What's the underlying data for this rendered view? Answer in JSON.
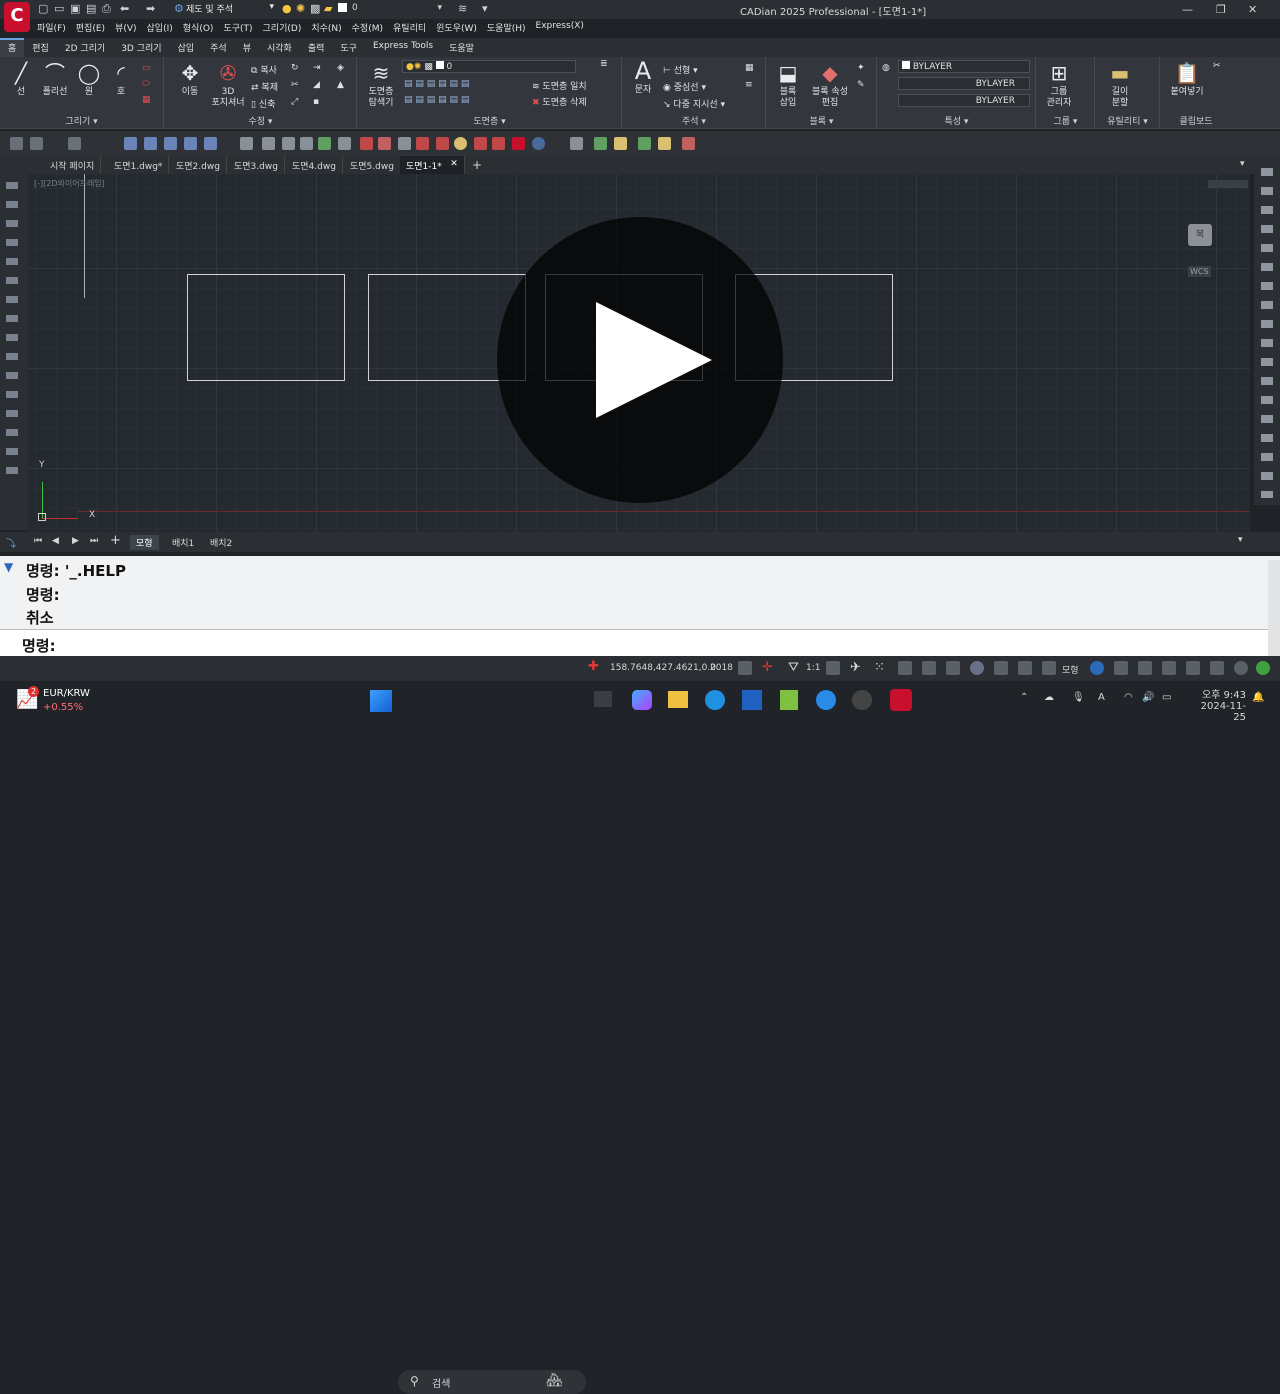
{
  "app": {
    "title": "CADian 2025 Professional - [도면1-1*]",
    "logo": "C"
  },
  "quick_access": {
    "workspace": "제도 및 주석",
    "layer_value": "0"
  },
  "menu": [
    "파일(F)",
    "편집(E)",
    "뷰(V)",
    "삽입(I)",
    "형식(O)",
    "도구(T)",
    "그리기(D)",
    "치수(N)",
    "수정(M)",
    "유틸리티",
    "윈도우(W)",
    "도움말(H)",
    "Express(X)"
  ],
  "ribbon_tabs": [
    "홈",
    "편집",
    "2D 그리기",
    "3D 그리기",
    "삽입",
    "주석",
    "뷰",
    "시각화",
    "출력",
    "도구",
    "Express Tools",
    "도움말"
  ],
  "ribbon": {
    "draw": {
      "label": "그리기 ▾",
      "line": "선",
      "polyline": "폴리선",
      "circle": "원",
      "arc": "호"
    },
    "modify": {
      "label": "수정 ▾",
      "move": "이동",
      "gizmo1": "3D",
      "gizmo2": "포지셔너",
      "copy": "복사",
      "mirror": "복제",
      "stretch": "신축"
    },
    "layer": {
      "label": "도면층 ▾",
      "manager1": "도면층",
      "manager2": "탐색기",
      "match": "도면층 일치",
      "delete": "도면층 삭제",
      "current": "0"
    },
    "annotation": {
      "label": "주석 ▾",
      "text": "문자",
      "linear": "선형",
      "center": "중심선",
      "multileader": "다중 지시선"
    },
    "block": {
      "label": "블록 ▾",
      "insert1": "블록",
      "insert2": "삽입",
      "attr1": "블록 속성",
      "attr2": "편집"
    },
    "properties": {
      "label": "특성 ▾",
      "color": "BYLAYER",
      "linetype": "BYLAYER",
      "lineweight": "BYLAYER"
    },
    "group": {
      "label": "그룹 ▾",
      "manager1": "그룹",
      "manager2": "관리자"
    },
    "utility": {
      "label": "유틸리티 ▾",
      "measure1": "길이",
      "measure2": "분할"
    },
    "clipboard": {
      "label": "클립보드",
      "paste": "붙여넣기"
    }
  },
  "doc_tabs": [
    "시작 페이지",
    "도면1.dwg*",
    "도면2.dwg",
    "도면3.dwg",
    "도면4.dwg",
    "도면5.dwg",
    "도면1-1*"
  ],
  "viewport": {
    "label": "[-][2D와이어프레임]",
    "navcube": "북",
    "wcs": "WCS",
    "axis_y": "Y",
    "axis_x": "X"
  },
  "layout_tabs": [
    "모형",
    "배치1",
    "배치2"
  ],
  "command": {
    "lines": [
      "명령: '_.HELP",
      "명령:",
      "취소"
    ],
    "prompt": "명령:"
  },
  "status": {
    "coords": "158.7648,427.4621,0.0",
    "year": "2018",
    "scale": "1:1",
    "mode": "모형"
  },
  "taskbar": {
    "ticker": "EUR/KRW",
    "change": "+0.55%",
    "badge": "2",
    "search": "검색",
    "time": "오후 9:43",
    "date": "2024-11-25"
  }
}
